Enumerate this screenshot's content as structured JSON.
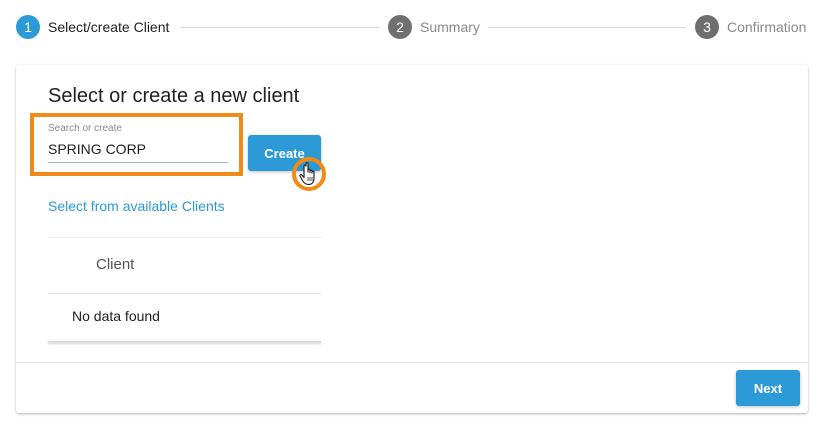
{
  "stepper": {
    "steps": [
      {
        "number": "1",
        "label": "Select/create Client",
        "state": "active"
      },
      {
        "number": "2",
        "label": "Summary",
        "state": "inactive"
      },
      {
        "number": "3",
        "label": "Confirmation",
        "state": "inactive"
      }
    ]
  },
  "card": {
    "title": "Select or create a new client",
    "search": {
      "label": "Search or create",
      "value": "SPRING CORP"
    },
    "create_label": "Create",
    "select_link": "Select from available Clients",
    "table": {
      "columns": [
        "Client"
      ],
      "empty_text": "No data found"
    },
    "next_label": "Next"
  },
  "colors": {
    "accent": "#2c9ad6",
    "highlight": "#f28a17",
    "inactive_step": "#6f6f6f"
  },
  "icons": {
    "cursor": "hand-pointer-icon"
  }
}
